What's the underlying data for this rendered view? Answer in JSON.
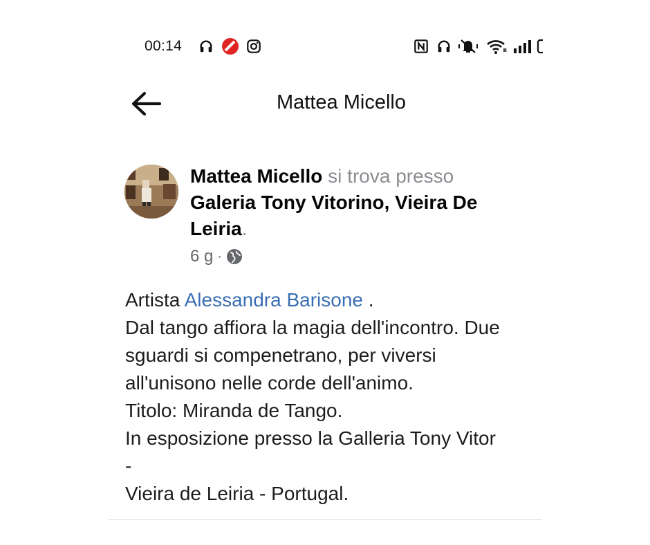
{
  "status_bar": {
    "time": "00:14",
    "left_icons": [
      "headphones-icon",
      "red-app-icon",
      "instagram-icon"
    ],
    "right_icons": [
      "nfc-icon",
      "headphones-icon",
      "vibrate-muted-icon",
      "wifi-icon",
      "signal-icon",
      "battery-icon"
    ]
  },
  "header": {
    "title": "Mattea Micello",
    "back_icon": "arrow-left-icon"
  },
  "post": {
    "author": "Mattea Micello",
    "action": " si trova presso",
    "place": "Galeria Tony Vitorino, Vieira De Leiria",
    "place_line1": "Galeria Tony Vitorino, Vieira De",
    "place_line2": "Leiria",
    "place_suffix": ".",
    "time": "6 g",
    "separator": "·",
    "privacy_icon": "globe-icon",
    "body": {
      "line1_prefix": "Artista ",
      "mention": "Alessandra Barisone",
      "line1_suffix": " .",
      "line2": "Dal tango affiora la magia dell'incontro. Due",
      "line3": "sguardi  si compenetrano, per  viversi",
      "line4": "all'unisono nelle corde dell'animo.",
      "line5": "Titolo: Miranda de Tango.",
      "line6": "In esposizione presso la Galleria Tony Vitor",
      "line7": "-",
      "line8": "Vieira de Leiria - Portugal."
    }
  },
  "colors": {
    "text": "#050505",
    "muted": "#8a8d91",
    "link": "#3a6fb3",
    "divider": "#dcdde1",
    "status_red": "#e02424"
  }
}
